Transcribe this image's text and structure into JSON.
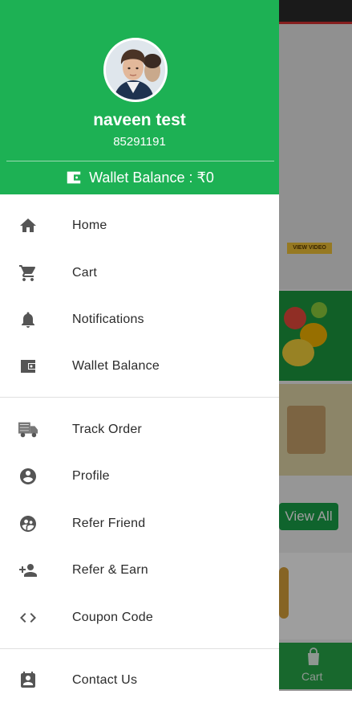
{
  "background": {
    "banner_badge": "VIEW VIDEO",
    "view_all_label": "View All",
    "bottom_nav_cart_label": "Cart",
    "cart_icon": "shopping-bag-icon"
  },
  "drawer": {
    "user": {
      "name": "naveen test",
      "phone": "85291191",
      "avatar": "user-avatar-photo"
    },
    "wallet": {
      "label": "Wallet Balance : ₹0",
      "icon": "wallet-icon"
    },
    "menu_groups": [
      [
        {
          "label": "Home",
          "icon": "home-icon"
        },
        {
          "label": "Cart",
          "icon": "cart-icon"
        },
        {
          "label": "Notifications",
          "icon": "bell-icon"
        },
        {
          "label": "Wallet Balance",
          "icon": "wallet-icon"
        }
      ],
      [
        {
          "label": "Track Order",
          "icon": "delivery-truck-icon"
        },
        {
          "label": "Profile",
          "icon": "account-circle-icon"
        },
        {
          "label": "Refer Friend",
          "icon": "people-circle-icon"
        },
        {
          "label": "Refer & Earn",
          "icon": "person-add-icon"
        },
        {
          "label": "Coupon Code",
          "icon": "code-brackets-icon"
        }
      ],
      [
        {
          "label": "Contact Us",
          "icon": "contact-calendar-icon"
        }
      ]
    ]
  },
  "colors": {
    "brand_green": "#1db154",
    "icon_gray": "#555555",
    "text_dark": "#2b2b2b"
  }
}
